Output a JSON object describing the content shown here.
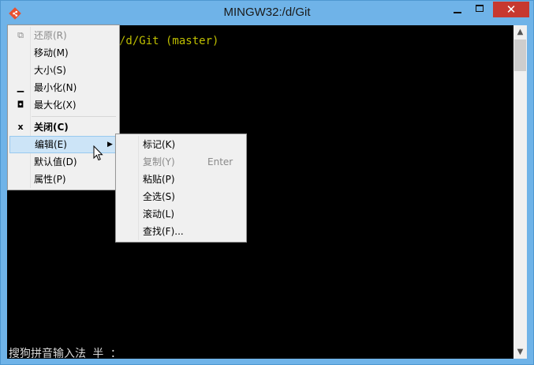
{
  "window": {
    "title": "MINGW32:/d/Git",
    "accent_color": "#6fb3e8",
    "close_color": "#c7382f",
    "icons": {
      "app": "git-diamond-icon",
      "minimize": "minimize-icon",
      "maximize": "maximize-icon",
      "close": "close-icon"
    },
    "close_glyph": "✕"
  },
  "console": {
    "prompt_visible": "/d/Git (master)",
    "ime_status": "搜狗拼音输入法 半 ："
  },
  "scrollbar": {
    "up_glyph": "▲",
    "down_glyph": "▼"
  },
  "system_menu": {
    "items": [
      {
        "label": "还原(R)",
        "icon": "restore-icon",
        "glyph": "⧉",
        "disabled": true
      },
      {
        "label": "移动(M)"
      },
      {
        "label": "大小(S)"
      },
      {
        "label": "最小化(N)",
        "icon": "minimize-icon",
        "glyph": "▁"
      },
      {
        "label": "最大化(X)",
        "icon": "maximize-icon",
        "glyph": "◘"
      },
      {
        "label": "关闭(C)",
        "icon": "close-icon",
        "glyph": "x",
        "bold": true
      },
      {
        "label": "编辑(E)",
        "has_submenu": true,
        "highlighted": true,
        "arrow": "▶"
      },
      {
        "label": "默认值(D)"
      },
      {
        "label": "属性(P)"
      }
    ]
  },
  "edit_submenu": {
    "items": [
      {
        "label": "标记(K)"
      },
      {
        "label": "复制(Y)",
        "shortcut": "Enter",
        "disabled": true
      },
      {
        "label": "粘贴(P)"
      },
      {
        "label": "全选(S)"
      },
      {
        "label": "滚动(L)"
      },
      {
        "label": "查找(F)..."
      }
    ]
  }
}
